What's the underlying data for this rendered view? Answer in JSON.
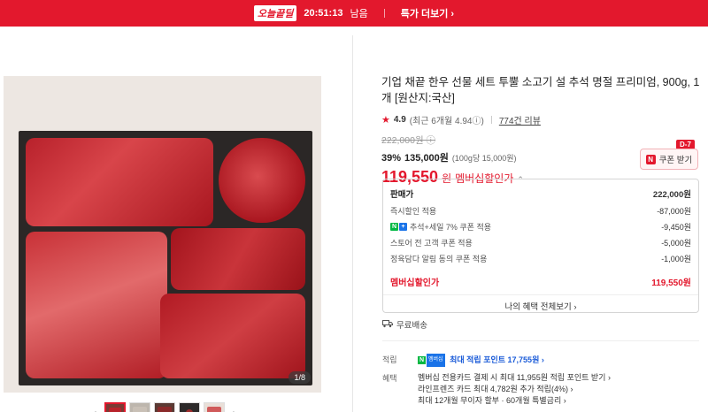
{
  "topbar": {
    "brand": "오늘끝딜",
    "timer": "20:51:13",
    "timer_suffix": "남음",
    "more": "특가 더보기 ›"
  },
  "gallery": {
    "counter": "1/8",
    "prev": "‹",
    "next": "›",
    "thumb_count": 5
  },
  "product": {
    "title": "기업 채끝 한우 선물 세트 투뿔 소고기 설 추석 명절 프리미엄, 900g, 1개 [원산지:국산]",
    "rating_score": "4.9",
    "rating_sub": "(최근 6개월 4.94ⓘ)",
    "reviews": "774건 리뷰",
    "original_price": "222,000원 ⓘ",
    "discount_pct": "39%",
    "sale_price": "135,000원",
    "unit_price": "(100g당 15,000원)",
    "member_price": "119,550",
    "member_won": "원",
    "member_label": "멤버십할인가",
    "member_chevron": "⌃"
  },
  "coupon": {
    "dday": "D-7",
    "n": "N",
    "label": "쿠폰 받기"
  },
  "breakdown": {
    "head_label": "판매가",
    "head_value": "222,000원",
    "rows": [
      {
        "label": "즉시할인 적용",
        "value": "-87,000원"
      },
      {
        "label": "추석+세일 7% 쿠폰 적용",
        "value": "-9,450원"
      },
      {
        "label": "스토어 전 고객 쿠폰 적용",
        "value": "-5,000원"
      },
      {
        "label": "정육담다 알림 동의 쿠폰 적용",
        "value": "-1,000원"
      }
    ],
    "total_label": "멤버십할인가",
    "total_value": "119,550원",
    "all_benefits": "나의 혜택 전체보기 ›"
  },
  "shipping": {
    "label": "무료배송"
  },
  "info": {
    "points_key": "적립",
    "points_text": "최대 적립 포인트 17,755원 ›",
    "benefits_key": "혜택",
    "benefit_lines": [
      "멤버십 전용카드 결제 시 최대 11,955원 적립 포인트 받기 ›",
      "라인프렌즈 카드 최대 4,782원 추가 적립(4%) ›",
      "최대 12개월 무이자 할부 · 60개월 특별금리 ›"
    ]
  },
  "colors": {
    "accent": "#e3182d",
    "points_blue": "#1a5bd8",
    "naver_green": "#00b843"
  }
}
